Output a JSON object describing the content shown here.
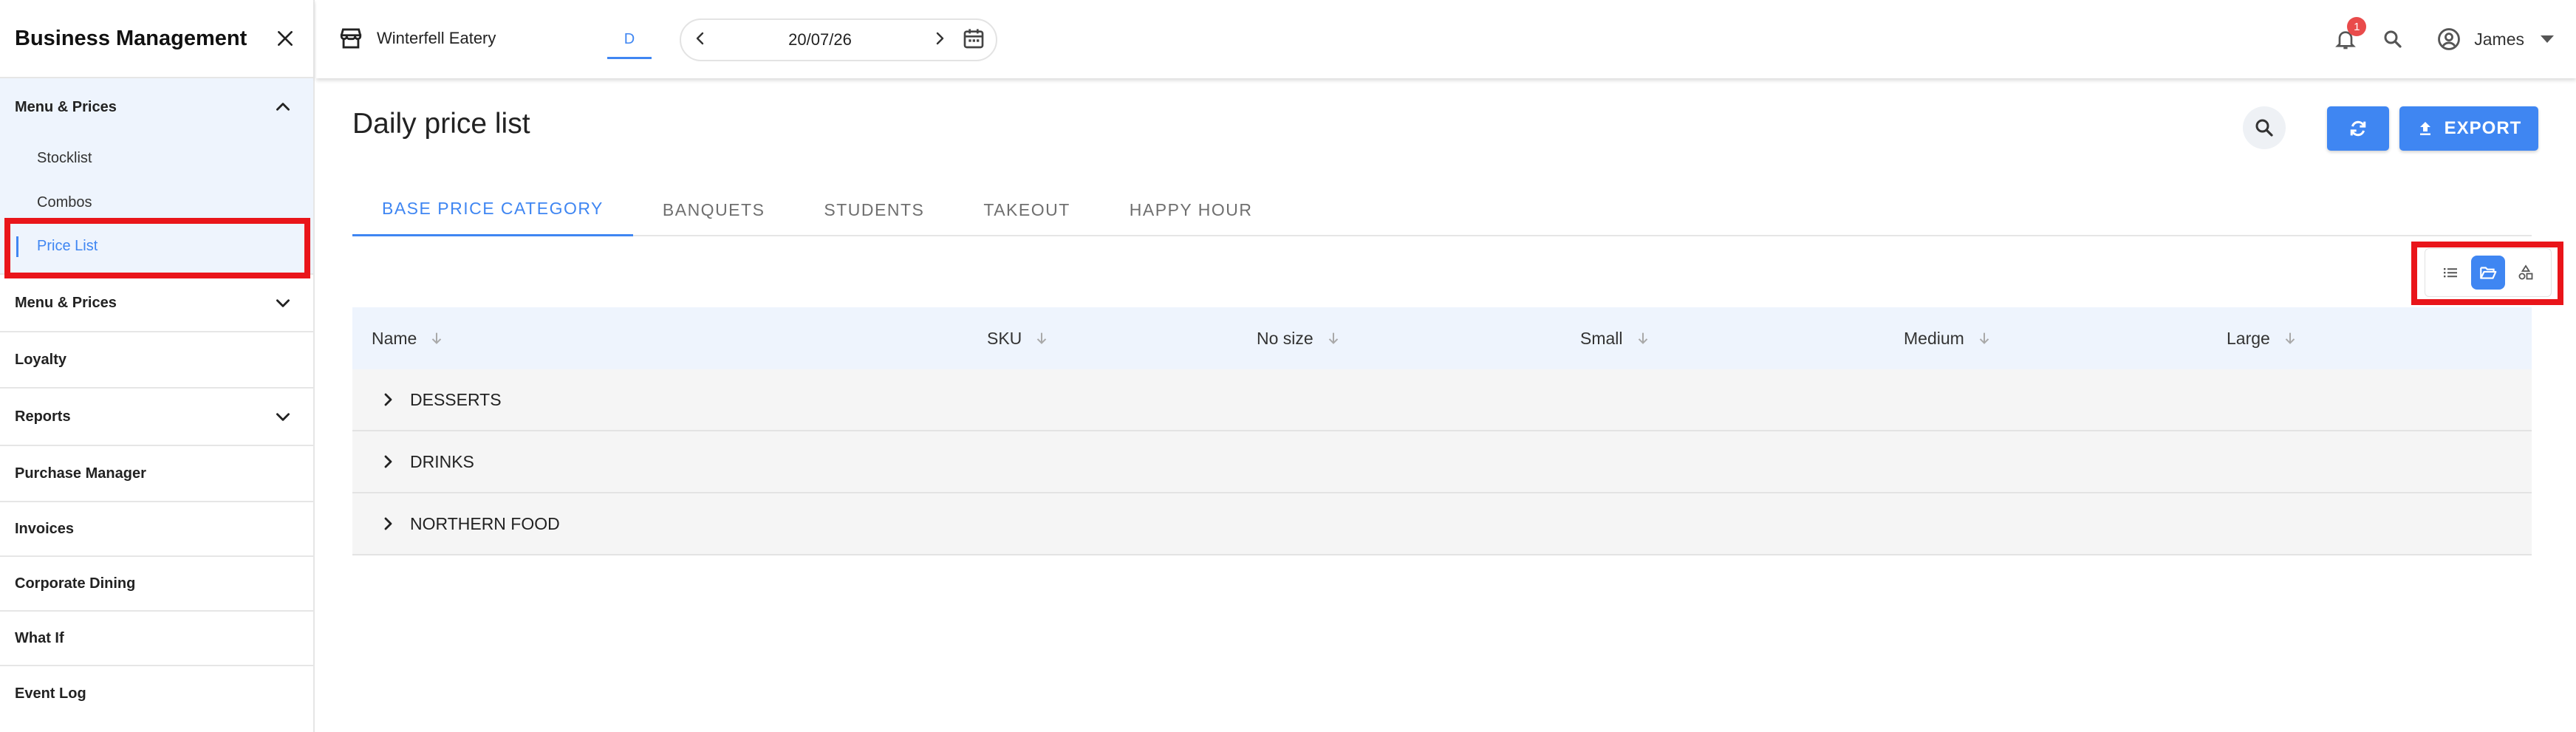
{
  "sidebar": {
    "title": "Business Management",
    "groups": [
      {
        "label": "Menu & Prices",
        "expanded": true,
        "items": [
          "Stocklist",
          "Combos",
          "Price List"
        ]
      },
      {
        "label": "Menu & Prices",
        "expanded": false
      },
      {
        "label": "Loyalty"
      },
      {
        "label": "Reports",
        "expanded": false
      },
      {
        "label": "Purchase Manager"
      },
      {
        "label": "Invoices"
      },
      {
        "label": "Corporate Dining"
      },
      {
        "label": "What If"
      },
      {
        "label": "Event Log"
      }
    ],
    "active_item": "Price List"
  },
  "topbar": {
    "store_name": "Winterfell Eatery",
    "view_mode": "D",
    "date": "20/07/26",
    "notification_count": "1",
    "user_name": "James"
  },
  "page": {
    "title": "Daily price list",
    "export_label": "EXPORT"
  },
  "tabs": [
    "BASE PRICE CATEGORY",
    "BANQUETS",
    "STUDENTS",
    "TAKEOUT",
    "HAPPY HOUR"
  ],
  "active_tab": "BASE PRICE CATEGORY",
  "view_toggle": {
    "options": [
      "list-view",
      "folder-view",
      "category-view"
    ],
    "active": "folder-view"
  },
  "table": {
    "columns": [
      "Name",
      "SKU",
      "No size",
      "Small",
      "Medium",
      "Large"
    ],
    "rows": [
      "DESSERTS",
      "DRINKS",
      "NORTHERN FOOD"
    ]
  },
  "colors": {
    "accent": "#3f86f2",
    "highlight": "#e9151a",
    "header_bg": "#eef4fd",
    "badge": "#e94b4b"
  },
  "highlighted": [
    "sidebar-item-price-list",
    "view-toggle-group"
  ]
}
